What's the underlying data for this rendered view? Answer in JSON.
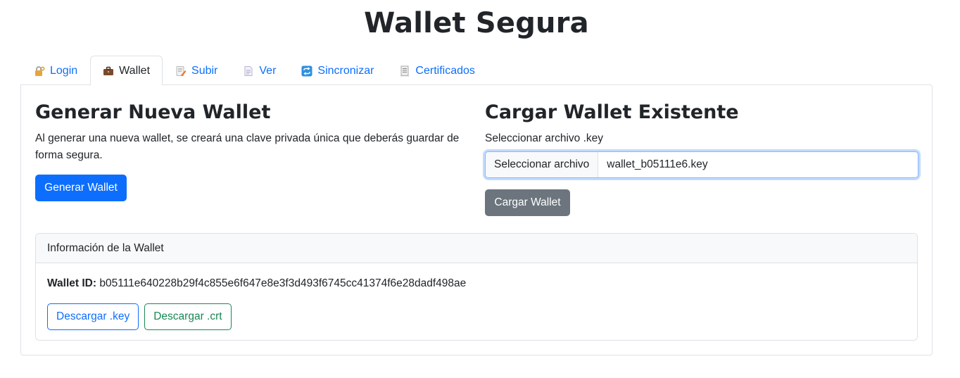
{
  "page": {
    "title": "Wallet Segura"
  },
  "tabs": [
    {
      "label": "Login",
      "icon": "lock-key-icon",
      "active": false
    },
    {
      "label": "Wallet",
      "icon": "briefcase-icon",
      "active": true
    },
    {
      "label": "Subir",
      "icon": "memo-pencil-icon",
      "active": false
    },
    {
      "label": "Ver",
      "icon": "page-icon",
      "active": false
    },
    {
      "label": "Sincronizar",
      "icon": "sync-arrows-icon",
      "active": false
    },
    {
      "label": "Certificados",
      "icon": "receipt-icon",
      "active": false
    }
  ],
  "generate": {
    "heading": "Generar Nueva Wallet",
    "description": "Al generar una nueva wallet, se creará una clave privada única que deberás guardar de forma segura.",
    "button_label": "Generar Wallet"
  },
  "load": {
    "heading": "Cargar Wallet Existente",
    "file_label": "Seleccionar archivo .key",
    "file_button_label": "Seleccionar archivo",
    "file_name": "wallet_b05111e6.key",
    "button_label": "Cargar Wallet"
  },
  "info": {
    "header": "Información de la Wallet",
    "wallet_id_label": "Wallet ID:",
    "wallet_id_value": "b05111e640228b29f4c855e6f647e8e3f3d493f6745cc41374f6e28dadf498ae",
    "download_key_label": "Descargar .key",
    "download_crt_label": "Descargar .crt"
  },
  "colors": {
    "primary": "#0d6efd",
    "secondary": "#6c757d",
    "success": "#198754",
    "border": "#dee2e6"
  }
}
